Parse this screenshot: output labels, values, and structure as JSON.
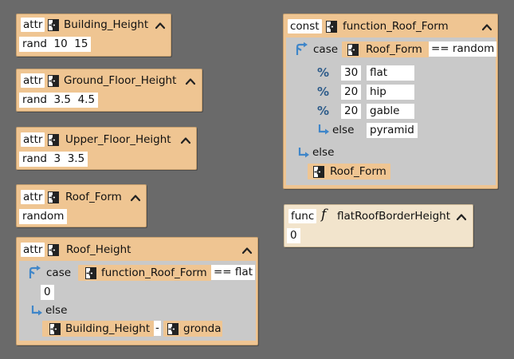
{
  "nodes": {
    "building_height": {
      "kw": "attr",
      "name": "Building_Height",
      "value": "rand  10  15"
    },
    "ground_floor_height": {
      "kw": "attr",
      "name": "Ground_Floor_Height",
      "value": "rand  3.5  4.5"
    },
    "upper_floor_height": {
      "kw": "attr",
      "name": "Upper_Floor_Height",
      "value": "rand  3  3.5"
    },
    "roof_form": {
      "kw": "attr",
      "name": "Roof_Form",
      "value": "random"
    },
    "roof_height": {
      "kw": "attr",
      "name": "Roof_Height",
      "case_label": "case",
      "case_ref": "function_Roof_Form",
      "case_op": "== flat",
      "case_value": "0",
      "else_label": "else",
      "else_ref1": "Building_Height",
      "else_op": "-",
      "else_ref2": "gronda"
    },
    "function_roof_form": {
      "kw": "const",
      "name": "function_Roof_Form",
      "case_label": "case",
      "case_ref": "Roof_Form",
      "case_op": "== random",
      "rows": [
        {
          "pct": "%",
          "num": "30",
          "val": "flat"
        },
        {
          "pct": "%",
          "num": "20",
          "val": "hip"
        },
        {
          "pct": "%",
          "num": "20",
          "val": "gable"
        }
      ],
      "inner_else_label": "else",
      "inner_else_val": "pyramid",
      "else_label": "else",
      "else_ref": "Roof_Form"
    },
    "flat_roof_border_height": {
      "kw": "func",
      "f_symbol": "f",
      "name": "flatRoofBorderHeight",
      "value": "0"
    }
  }
}
